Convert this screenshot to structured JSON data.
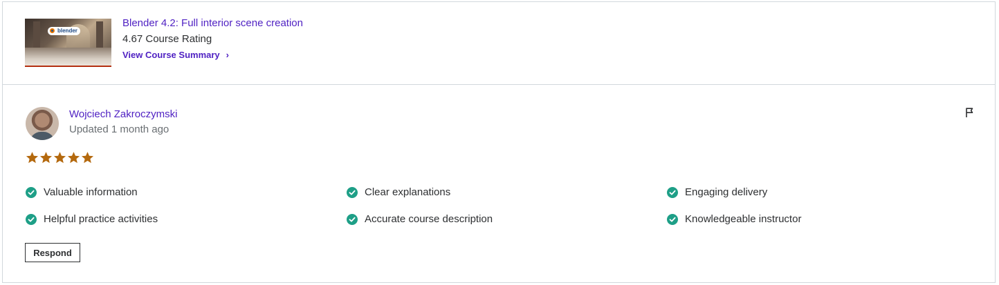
{
  "course": {
    "thumbnail_logo": "blender",
    "title": "Blender 4.2: Full interior scene creation",
    "rating": "4.67 Course Rating",
    "summary_link": "View Course Summary",
    "summary_chevron": "›"
  },
  "review": {
    "reviewer_name": "Wojciech Zakroczymski",
    "updated": "Updated 1 month ago",
    "stars": 5,
    "star_color": "#b4690e",
    "flag_icon": "flag-icon",
    "tags": [
      "Valuable information",
      "Clear explanations",
      "Engaging delivery",
      "Helpful practice activities",
      "Accurate course description",
      "Knowledgeable instructor"
    ],
    "check_color": "#1e9f87",
    "respond_label": "Respond"
  },
  "colors": {
    "link": "#5022c3",
    "text": "#2d2f31",
    "muted": "#6a6f73",
    "border": "#d1d7dc"
  }
}
